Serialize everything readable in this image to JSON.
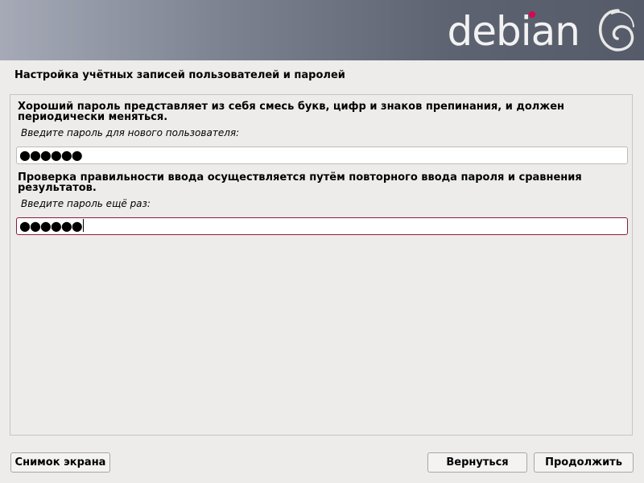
{
  "banner": {
    "wordmark": "debian"
  },
  "page_title": "Настройка учётных записей пользователей и паролей",
  "form": {
    "description1": "Хороший пароль представляет из себя смесь букв, цифр и знаков препинания, и должен периодически меняться.",
    "label1": "Введите пароль для нового пользователя:",
    "password1_mask": "●●●●●●",
    "description2": "Проверка правильности ввода осуществляется путём повторного ввода пароля и сравнения результатов.",
    "label2": "Введите пароль ещё раз:",
    "password2_mask": "●●●●●●"
  },
  "buttons": {
    "screenshot": "Снимок экрана",
    "back": "Вернуться",
    "continue": "Продолжить"
  },
  "colors": {
    "accent": "#d70751",
    "focus_border": "#8b1a3a"
  }
}
